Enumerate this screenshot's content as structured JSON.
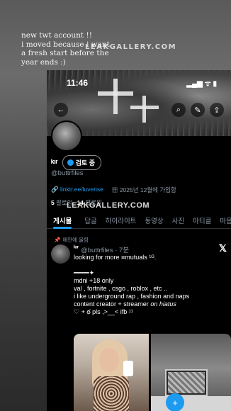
{
  "story": {
    "caption": "new twt account  !!\ni moved because i want\na fresh start before the\nyear ends :)",
    "watermark_top": "LEAKGALLERY.COM",
    "watermark_mid": "LEAKGALLERY.COM"
  },
  "statusbar": {
    "time": "11:46",
    "icons": "▂▄▆ ᯤ ▮"
  },
  "nav": {
    "back": "←",
    "search": "⌕",
    "edit": "✎",
    "share": "⇪"
  },
  "profile": {
    "name": "ᵏᶦʳ",
    "verify_label": "검토 중",
    "handle": "@buttrfiles",
    "link": "linktr.ee/luvense",
    "joined": "2025년 12월에 가입함",
    "following_count": "5",
    "following_label": "팔로잉",
    "followers_count": "14",
    "followers_label": "팔로워"
  },
  "tabs": [
    "게시물",
    "답글",
    "하이라이트",
    "동영상",
    "사진",
    "아티클",
    "마음에"
  ],
  "post": {
    "pinned_label": "에안에 올림",
    "author": "ᵏᶦʳ",
    "handle_time": "@buttrfiles · 7분",
    "body": "looking for more  ≡mutuals ¹ᴳ.\n\n             ━━━━✦\nmdni +18 only\nval , fortnite , csgo , roblox , etc ..\ni like underground rap , fashion and naps\ncontent creator + streamer",
    "body_italic": " on hiatus",
    "footer": "\n♡ + ఠ  pls ,>__< ifb ¹¹"
  },
  "compose_icon": "+"
}
